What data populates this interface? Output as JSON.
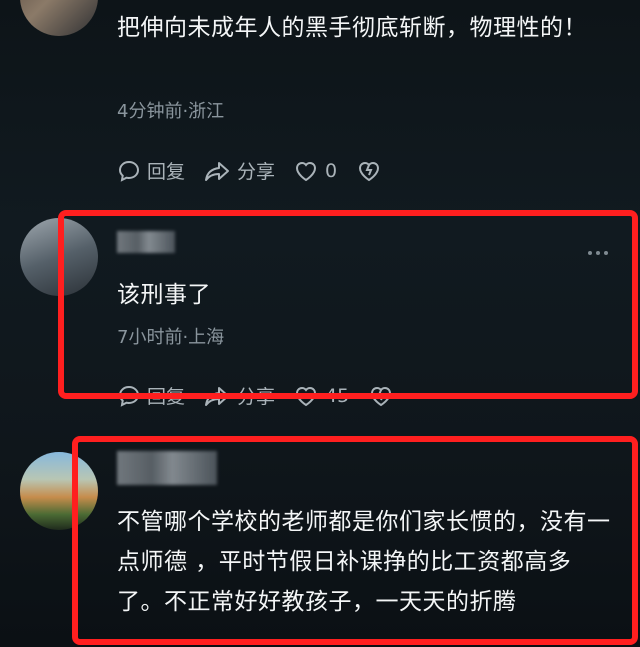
{
  "comments": [
    {
      "text": "把伸向未成年人的黑手彻底斩断，物理性的！",
      "meta": "4分钟前·浙江",
      "reply_label": "回复",
      "share_label": "分享",
      "like_count": "0"
    },
    {
      "text": "该刑事了",
      "meta": "7小时前·上海",
      "reply_label": "回复",
      "share_label": "分享",
      "like_count": "45"
    },
    {
      "text": "不管哪个学校的老师都是你们家长惯的，没有一点师德 ，平时节假日补课挣的比工资都高多了。不正常好好教孩子，一天天的折腾"
    }
  ],
  "colors": {
    "highlight": "#ff1f1f",
    "text": "#f4f6f7",
    "meta": "#8a959d",
    "action": "#aab3b9"
  },
  "icons": [
    "reply-icon",
    "share-icon",
    "heart-icon",
    "broken-heart-icon",
    "more-icon"
  ]
}
